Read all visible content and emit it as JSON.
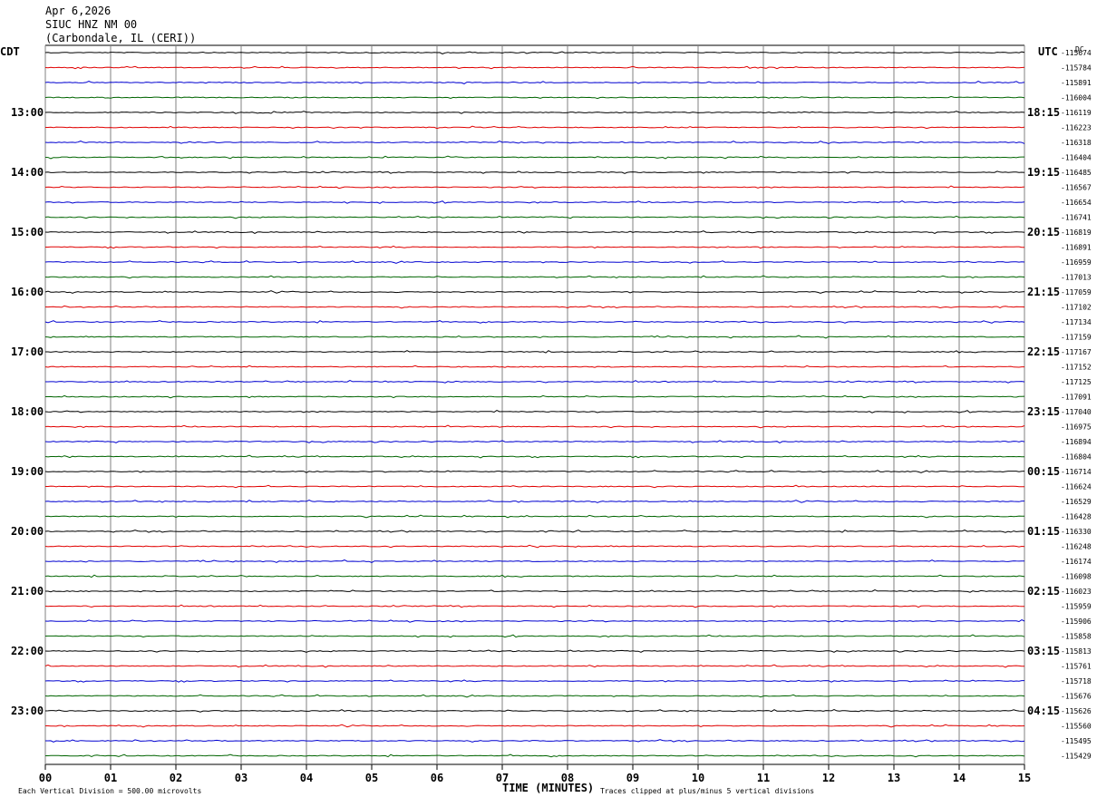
{
  "header": {
    "date": "Apr 6,2026",
    "station": "SIUC HNZ NM 00",
    "location": "(Carbondale, IL (CERI))"
  },
  "chart_data": {
    "type": "line",
    "title": "Apr 6,2026",
    "xlabel": "TIME (MINUTES)",
    "xlim": [
      0,
      15
    ],
    "x_ticks": [
      "00",
      "01",
      "02",
      "03",
      "04",
      "05",
      "06",
      "07",
      "08",
      "09",
      "10",
      "11",
      "12",
      "13",
      "14",
      "15"
    ],
    "left_axis_label": "CDT",
    "right_axis_label": "UTC",
    "dc_label": "DC",
    "left_time_labels": [
      "13:00",
      "14:00",
      "15:00",
      "16:00",
      "17:00",
      "18:00",
      "19:00",
      "20:00",
      "21:00",
      "22:00",
      "23:00"
    ],
    "right_time_labels": [
      "18:15",
      "19:15",
      "20:15",
      "21:15",
      "22:15",
      "23:15",
      "00:15",
      "01:15",
      "02:15",
      "03:15",
      "04:15"
    ],
    "trace_colors": [
      "#000000",
      "#e00000",
      "#0000d0",
      "#006400"
    ],
    "trace_dc_offsets": [
      "-115674",
      "-115784",
      "-115891",
      "-116004",
      "-116119",
      "-116223",
      "-116318",
      "-116404",
      "-116485",
      "-116567",
      "-116654",
      "-116741",
      "-116819",
      "-116891",
      "-116959",
      "-117013",
      "-117059",
      "-117102",
      "-117134",
      "-117159",
      "-117167",
      "-117152",
      "-117125",
      "-117091",
      "-117040",
      "-116975",
      "-116894",
      "-116804",
      "-116714",
      "-116624",
      "-116529",
      "-116428",
      "-116330",
      "-116248",
      "-116174",
      "-116098",
      "-116023",
      "-115959",
      "-115906",
      "-115858",
      "-115813",
      "-115761",
      "-115718",
      "-115676",
      "-115626",
      "-115560",
      "-115495",
      "-115429"
    ],
    "grid": true,
    "footer_scale": "Each Vertical Division =  500.00 microvolts",
    "footer_clip": "Traces clipped at plus/minus 5 vertical divisions"
  }
}
